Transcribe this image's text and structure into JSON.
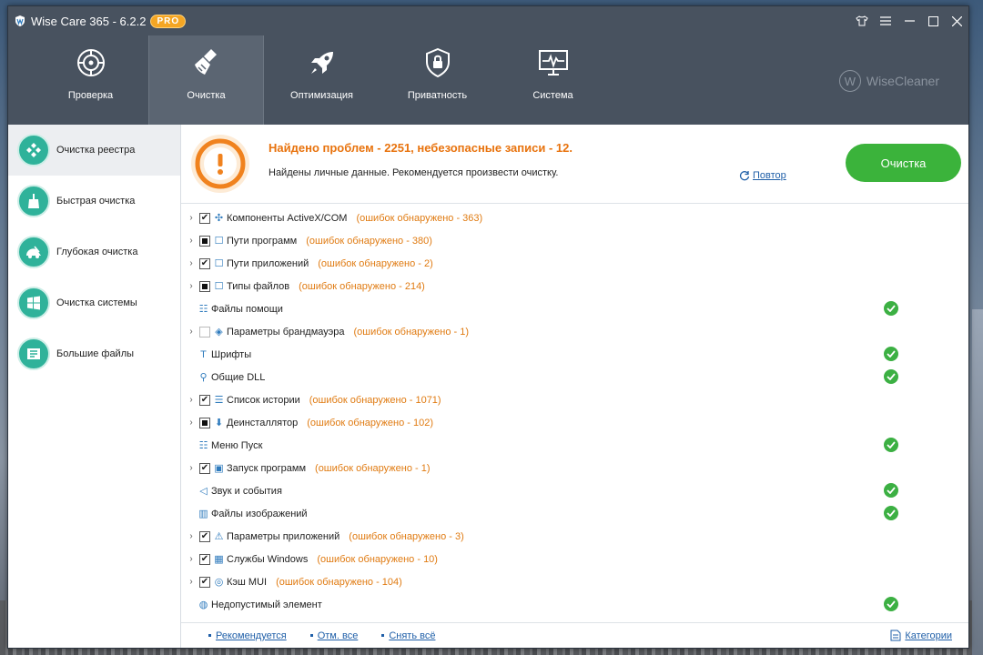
{
  "window": {
    "title": "Wise Care 365 - 6.2.2",
    "badge": "PRO"
  },
  "nav": {
    "tabs": [
      {
        "label": "Проверка",
        "icon": "target-icon"
      },
      {
        "label": "Очистка",
        "icon": "broom-icon"
      },
      {
        "label": "Оптимизация",
        "icon": "rocket-icon"
      },
      {
        "label": "Приватность",
        "icon": "lock-icon"
      },
      {
        "label": "Система",
        "icon": "monitor-icon"
      }
    ],
    "active": 1,
    "brand": "WiseCleaner"
  },
  "sidebar": {
    "items": [
      {
        "label": "Очистка реестра",
        "icon": "registry-icon"
      },
      {
        "label": "Быстрая очистка",
        "icon": "quick-clean-icon"
      },
      {
        "label": "Глубокая очистка",
        "icon": "deep-clean-icon"
      },
      {
        "label": "Очистка системы",
        "icon": "windows-icon"
      },
      {
        "label": "Большие файлы",
        "icon": "big-files-icon"
      }
    ],
    "active": 0
  },
  "banner": {
    "title": "Найдено проблем - 2251, небезопасные записи - 12.",
    "subtitle": "Найдены личные данные. Рекомендуется произвести очистку.",
    "retry": "Повтор",
    "clean_button": "Очистка"
  },
  "list": {
    "rows": [
      {
        "label": "Компоненты ActiveX/COM",
        "error": "(ошибок обнаружено - 363)",
        "check": "checked",
        "expandable": true,
        "ok": false
      },
      {
        "label": "Пути программ",
        "error": "(ошибок обнаружено - 380)",
        "check": "partial",
        "expandable": true,
        "ok": false
      },
      {
        "label": "Пути приложений",
        "error": "(ошибок обнаружено - 2)",
        "check": "checked",
        "expandable": true,
        "ok": false
      },
      {
        "label": "Типы файлов",
        "error": "(ошибок обнаружено - 214)",
        "check": "partial",
        "expandable": true,
        "ok": false
      },
      {
        "label": "Файлы помощи",
        "error": "",
        "check": "none",
        "expandable": false,
        "ok": true
      },
      {
        "label": "Параметры брандмауэра",
        "error": "(ошибок обнаружено - 1)",
        "check": "empty",
        "expandable": true,
        "ok": false
      },
      {
        "label": "Шрифты",
        "error": "",
        "check": "none",
        "expandable": false,
        "ok": true
      },
      {
        "label": "Общие DLL",
        "error": "",
        "check": "none",
        "expandable": false,
        "ok": true
      },
      {
        "label": "Список истории",
        "error": "(ошибок обнаружено - 1071)",
        "check": "checked",
        "expandable": true,
        "ok": false
      },
      {
        "label": "Деинсталлятор",
        "error": "(ошибок обнаружено - 102)",
        "check": "partial",
        "expandable": true,
        "ok": false
      },
      {
        "label": "Меню Пуск",
        "error": "",
        "check": "none",
        "expandable": false,
        "ok": true
      },
      {
        "label": "Запуск программ",
        "error": "(ошибок обнаружено - 1)",
        "check": "checked",
        "expandable": true,
        "ok": false
      },
      {
        "label": "Звук и события",
        "error": "",
        "check": "none",
        "expandable": false,
        "ok": true
      },
      {
        "label": "Файлы изображений",
        "error": "",
        "check": "none",
        "expandable": false,
        "ok": true
      },
      {
        "label": "Параметры приложений",
        "error": "(ошибок обнаружено - 3)",
        "check": "checked",
        "expandable": true,
        "ok": false
      },
      {
        "label": "Службы Windows",
        "error": "(ошибок обнаружено - 10)",
        "check": "checked",
        "expandable": true,
        "ok": false
      },
      {
        "label": "Кэш MUI",
        "error": "(ошибок обнаружено - 104)",
        "check": "checked",
        "expandable": true,
        "ok": false
      },
      {
        "label": "Недопустимый элемент",
        "error": "",
        "check": "none",
        "expandable": false,
        "ok": true
      }
    ]
  },
  "footer": {
    "recommended": "Рекомендуется",
    "select_all": "Отм. все",
    "deselect_all": "Снять всё",
    "categories": "Категории"
  },
  "colors": {
    "titlebar": "#48525f",
    "accent_green": "#3bb33b",
    "error_orange": "#e07b12",
    "sidebar_teal": "#2fb29a",
    "link_blue": "#1f5fa8"
  }
}
